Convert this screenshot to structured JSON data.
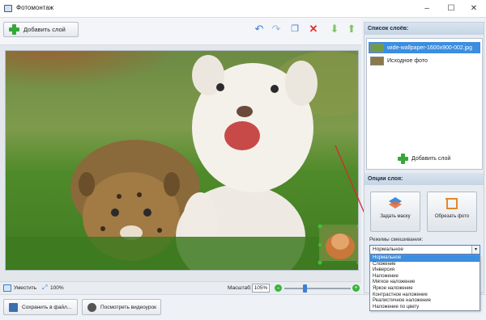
{
  "window": {
    "title": "Фотомонтаж",
    "minimize": "–",
    "maximize": "☐",
    "close": "✕"
  },
  "toolbar": {
    "add_layer_label": "Добавить слой"
  },
  "status": {
    "fit_label": "Уместить",
    "zoom_100": "100%",
    "scale_label": "Масштаб:",
    "scale_value": "105%",
    "zoom_slider_fraction": 0.3
  },
  "bottom": {
    "save_label": "Сохранить в файл...",
    "video_label": "Посмотреть видеоурок"
  },
  "layers": {
    "title": "Список слоёв:",
    "items": [
      {
        "label": "wide-wallpaper-1600x900-002.jpg",
        "selected": true
      },
      {
        "label": "Исходное фото",
        "selected": false
      }
    ],
    "add_label": "Добавить слой"
  },
  "options": {
    "title": "Опции слоя:",
    "mask_label": "Задать маску",
    "crop_label": "Обрезать фото",
    "blend_label": "Режимы смешивания:",
    "blend_value": "Нормальное",
    "blend_options": [
      "Нормальное",
      "Сложение",
      "Инверсия",
      "Наложение",
      "Мягкое наложение",
      "Яркое наложение",
      "Контрастное наложение",
      "Реалистичное наложение",
      "Наложение по цвету"
    ]
  },
  "colors": {
    "accent": "#3b8ee0",
    "plus_green": "#35a83a",
    "delete_red": "#e0302a",
    "arrow_red": "#d42a2a"
  }
}
